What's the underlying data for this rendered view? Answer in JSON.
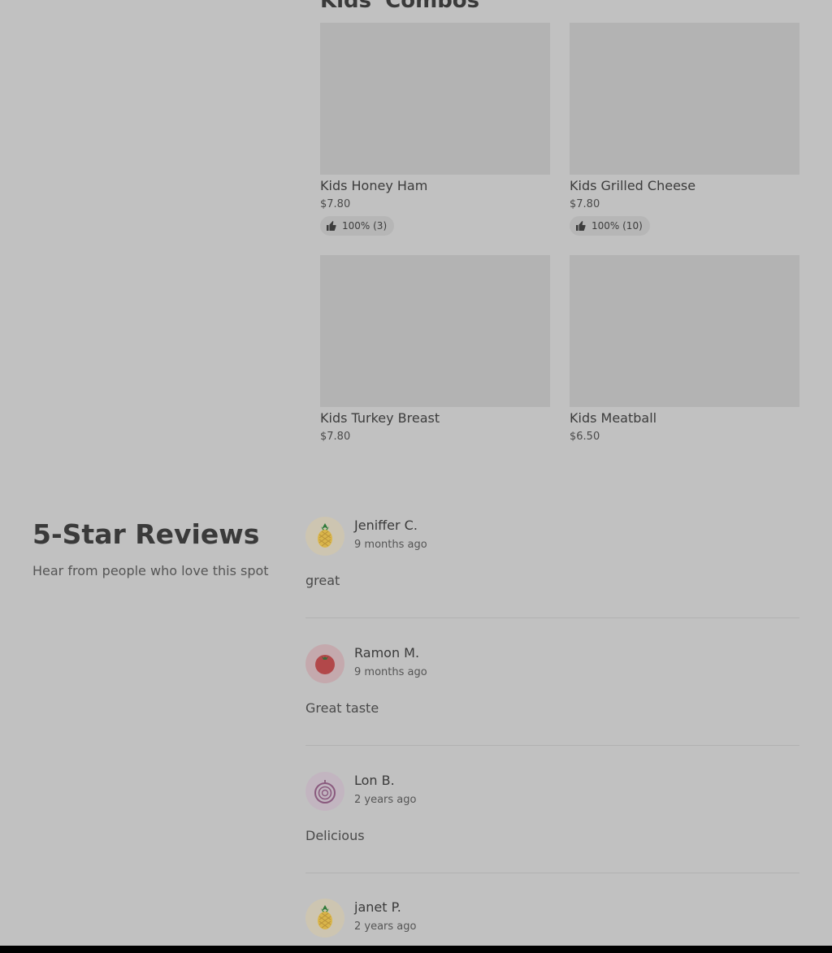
{
  "section": {
    "title": "Kids' Combos"
  },
  "items": [
    {
      "name": "Kids Honey Ham",
      "price": "$7.80",
      "rating": "100% (3)"
    },
    {
      "name": "Kids Grilled Cheese",
      "price": "$7.80",
      "rating": "100% (10)"
    },
    {
      "name": "Kids Turkey Breast",
      "price": "$7.80"
    },
    {
      "name": "Kids Meatball",
      "price": "$6.50"
    }
  ],
  "reviews_section": {
    "title": "5-Star Reviews",
    "subtitle": "Hear from people who love this spot"
  },
  "reviews": [
    {
      "name": "Jeniffer C.",
      "time": "9 months ago",
      "text": "great",
      "avatar_icon": "pineapple-icon"
    },
    {
      "name": "Ramon M.",
      "time": "9 months ago",
      "text": "Great taste",
      "avatar_icon": "tomato-icon"
    },
    {
      "name": "Lon B.",
      "time": "2 years ago",
      "text": "Delicious",
      "avatar_icon": "onion-icon"
    },
    {
      "name": "janet P.",
      "time": "2 years ago",
      "text": "",
      "avatar_icon": "pineapple-icon"
    }
  ],
  "colors": {
    "overlay_background": "#c1c1c1",
    "image_placeholder": "#b3b3b3",
    "pineapple_avatar_bg": "#cdc5b1",
    "tomato_avatar_bg": "#c4a9ad",
    "onion_avatar_bg": "#c2b5c0"
  }
}
